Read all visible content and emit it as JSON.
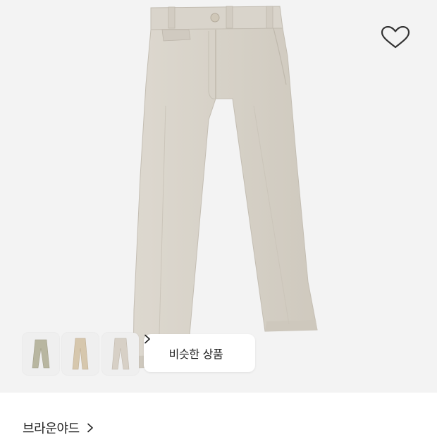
{
  "product": {
    "image_name": "beige-wide-chino-pants",
    "colors": {
      "background": "#f3f3f3",
      "fabric": "#d8d3ca",
      "fabric_shadow": "#c3bdb2"
    }
  },
  "thumbnails": [
    {
      "name": "thumbnail-1",
      "color": "#b8b6a0"
    },
    {
      "name": "thumbnail-2",
      "color": "#d6c7ad"
    },
    {
      "name": "thumbnail-3",
      "color": "#d7d0c6"
    }
  ],
  "similar_products": {
    "label": "비슷한 상품",
    "icon": "chevron-right-icon"
  },
  "brand": {
    "name": "브라운야드",
    "icon": "chevron-right-icon"
  },
  "wishlist": {
    "icon": "heart-icon"
  }
}
